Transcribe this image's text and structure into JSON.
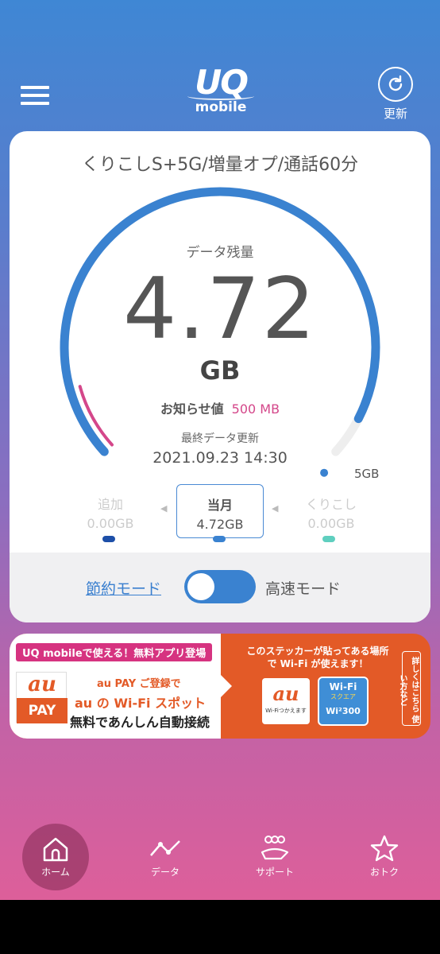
{
  "header": {
    "logo_main": "UQ",
    "logo_sub": "mobile",
    "refresh_label": "更新"
  },
  "plan": {
    "name": "くりこしS+5G/増量オプ/通話60分"
  },
  "usage": {
    "remaining_label": "データ残量",
    "remaining_value": "4.72",
    "remaining_unit": "GB",
    "remaining_fraction": 0.944,
    "notice_label": "お知らせ値",
    "notice_value": "500 MB",
    "notice_fraction": 0.1,
    "updated_label": "最終データ更新",
    "updated_value": "2021.09.23 14:30",
    "max_label": "5GB"
  },
  "tabs": [
    {
      "title": "追加",
      "value": "0.00GB",
      "color": "#1d4fa8"
    },
    {
      "title": "当月",
      "value": "4.72GB",
      "color": "#3a82d0"
    },
    {
      "title": "くりこし",
      "value": "0.00GB",
      "color": "#5fcfbf"
    }
  ],
  "mode": {
    "saver_label": "節約モード",
    "fast_label": "高速モード",
    "fast_enabled": true
  },
  "banner": {
    "headline": "UQ mobileで使える！無料アプリ登場",
    "au_text": "au",
    "pay_text": "PAY",
    "line1": "au PAY ご登録で",
    "line2": "au の Wi-Fi スポット",
    "line3": "無料であんしん自動接続",
    "right_text": "このステッカーが貼ってある場所で Wi-Fi が使えます！",
    "sticker_au": "au",
    "sticker_au_caption": "Wi-Fiつかえます",
    "sticker_wifi_1": "Wi-Fi",
    "sticker_wifi_2": "スクエア",
    "sticker_wifi_3": "Wi²300",
    "details": "詳しくはこちら 使い方など"
  },
  "nav": [
    {
      "label": "ホーム",
      "icon": "home-icon",
      "active": true
    },
    {
      "label": "データ",
      "icon": "chart-icon",
      "active": false
    },
    {
      "label": "サポート",
      "icon": "support-icon",
      "active": false
    },
    {
      "label": "おトク",
      "icon": "star-icon",
      "active": false
    }
  ],
  "colors": {
    "accent_blue": "#3a82d0",
    "notice_pink": "#d4478a",
    "banner_orange": "#e35a27"
  }
}
